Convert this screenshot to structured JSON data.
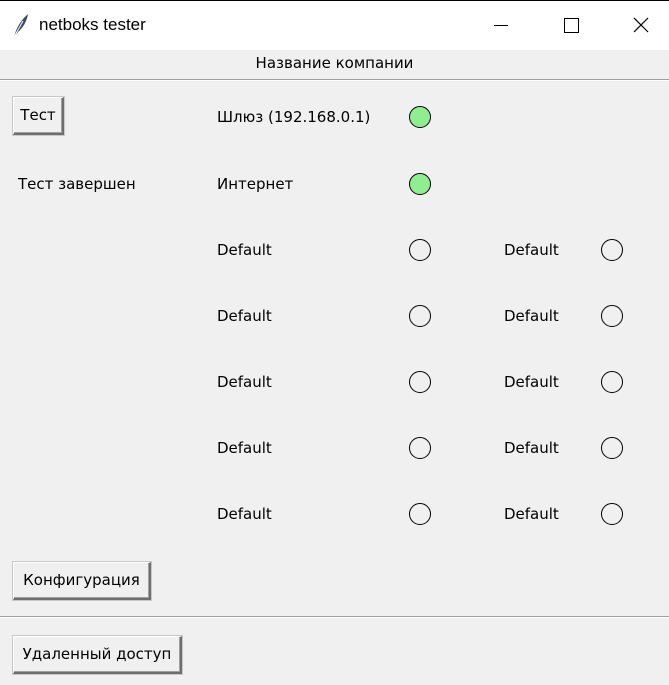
{
  "window": {
    "title": "netboks tester",
    "icon": "feather-icon",
    "controls": [
      "minimize-icon",
      "maximize-icon",
      "close-icon"
    ]
  },
  "header": {
    "company_name": "Название компании"
  },
  "buttons": {
    "test": "Тест",
    "config": "Конфигурация",
    "remote": "Удаленный доступ"
  },
  "status_text": "Тест завершен",
  "checks": {
    "left": [
      {
        "label": "Шлюз (192.168.0.1)",
        "ok": true
      },
      {
        "label": "Интернет",
        "ok": true
      },
      {
        "label": "Default",
        "ok": false
      },
      {
        "label": "Default",
        "ok": false
      },
      {
        "label": "Default",
        "ok": false
      },
      {
        "label": "Default",
        "ok": false
      },
      {
        "label": "Default",
        "ok": false
      }
    ],
    "right": [
      {
        "label": "Default",
        "ok": false
      },
      {
        "label": "Default",
        "ok": false
      },
      {
        "label": "Default",
        "ok": false
      },
      {
        "label": "Default",
        "ok": false
      },
      {
        "label": "Default",
        "ok": false
      }
    ]
  },
  "colors": {
    "ok_indicator": "#90ee90",
    "window_bg": "#f0f0f0",
    "titlebar_bg": "#ffffff"
  }
}
